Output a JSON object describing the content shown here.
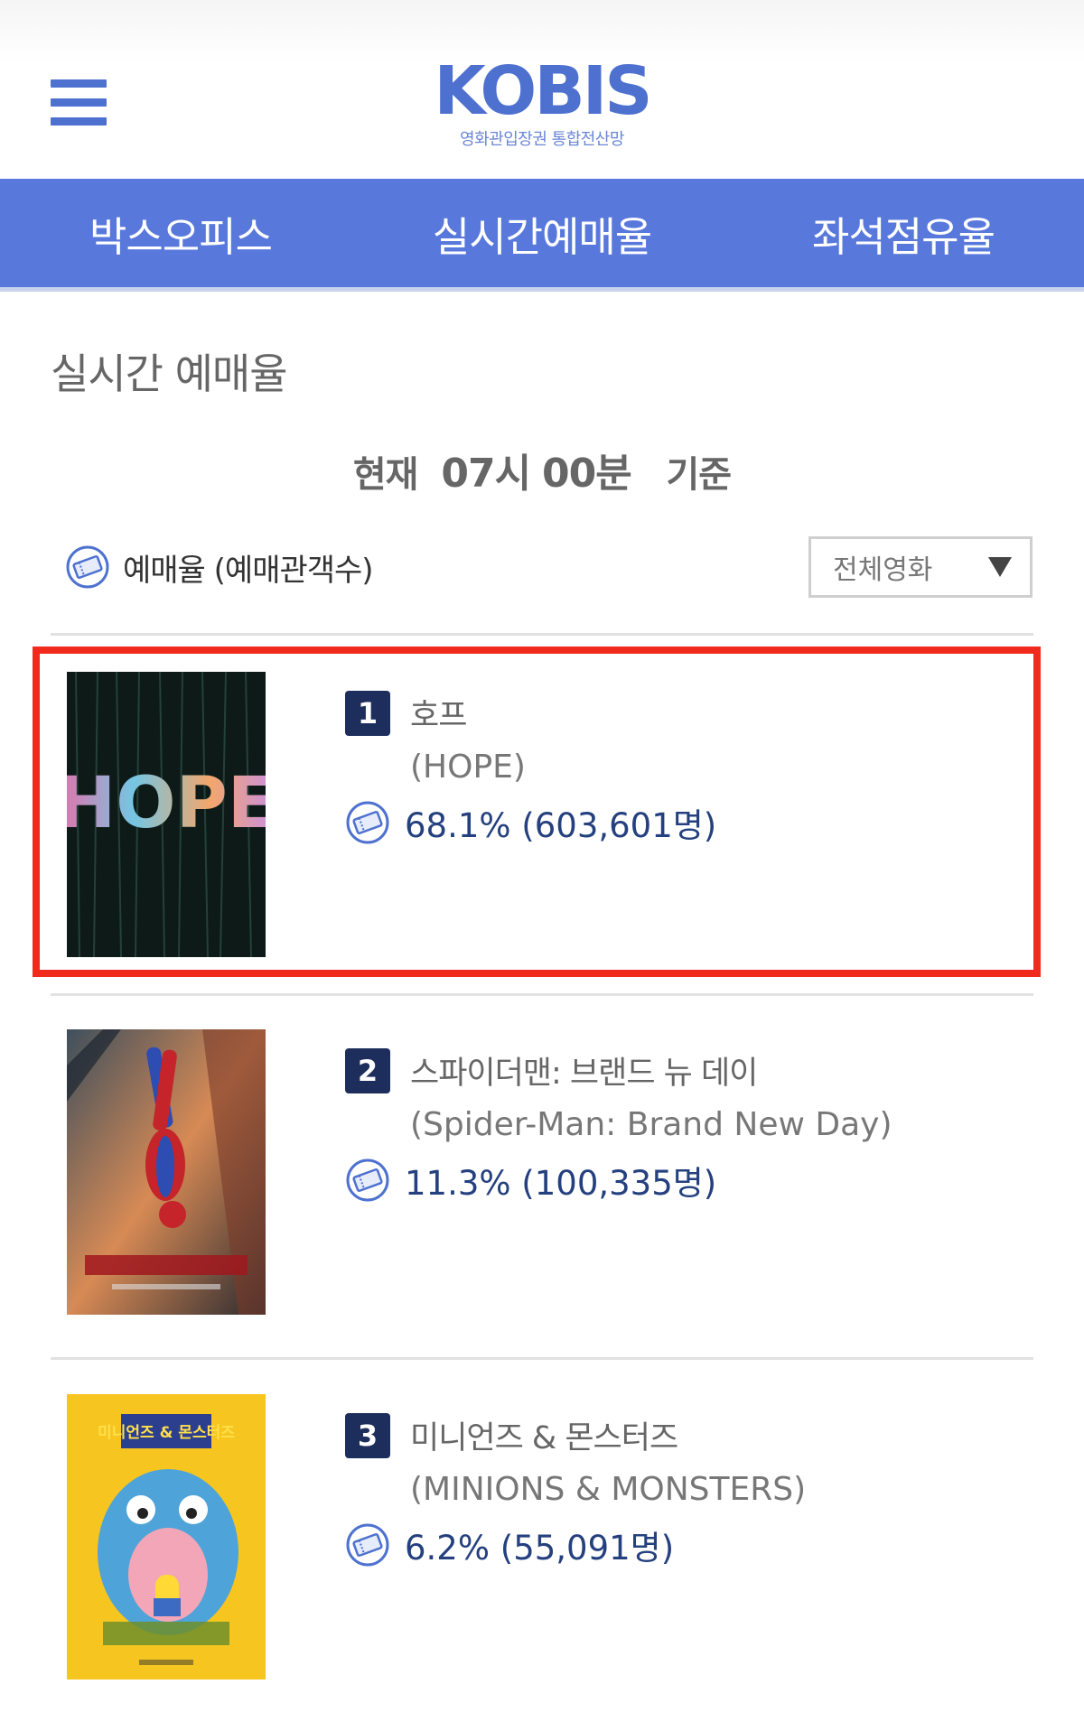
{
  "brand": {
    "name": "KOBIS",
    "subtitle": "영화관입장권 통합전산망",
    "color": "#4e71d0"
  },
  "nav": {
    "tabs": [
      "박스오피스",
      "실시간예매율",
      "좌석점유율"
    ],
    "background": "#5878dc"
  },
  "page": {
    "title": "실시간 예매율",
    "time": {
      "prefix": "현재",
      "hour": "07시",
      "minute": "00분",
      "suffix": "기준"
    },
    "legend_label": "예매율 (예매관객수)",
    "filter": {
      "selected": "전체영화"
    }
  },
  "movies": [
    {
      "rank": "1",
      "title_ko": "호프",
      "title_en": "(HOPE)",
      "rate": "68.1% (603,601명)",
      "poster_text": "HOPE",
      "highlighted": true
    },
    {
      "rank": "2",
      "title_ko": "스파이더맨: 브랜드 뉴 데이",
      "title_en": "(Spider-Man: Brand New Day)",
      "rate": "11.3% (100,335명)",
      "poster_text": "",
      "highlighted": false
    },
    {
      "rank": "3",
      "title_ko": "미니언즈 & 몬스터즈",
      "title_en": "(MINIONS & MONSTERS)",
      "rate": "6.2% (55,091명)",
      "poster_text": "미니언즈 & 몬스터즈",
      "highlighted": false
    }
  ],
  "colors": {
    "highlight": "#f02a1c",
    "rank_badge": "#1d2e5c",
    "rate_text": "#24407e"
  }
}
